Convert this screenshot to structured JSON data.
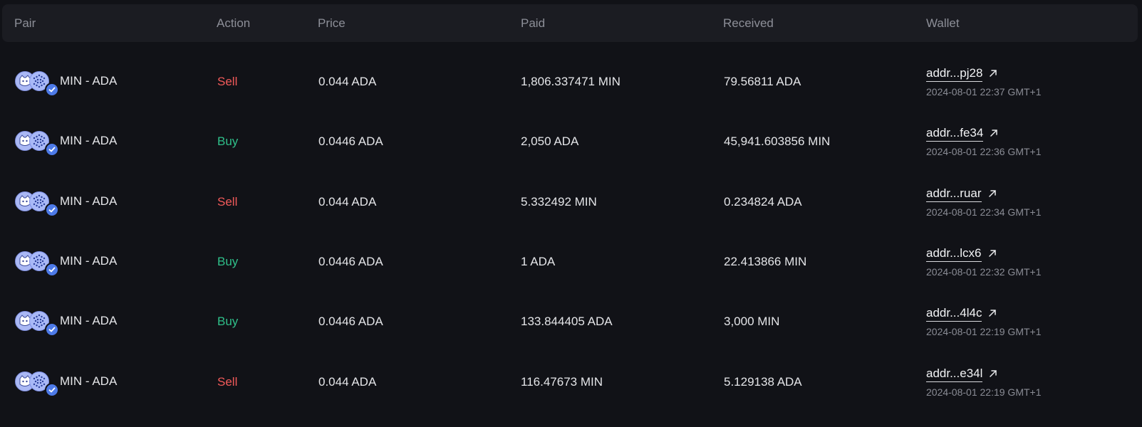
{
  "columns": [
    "Pair",
    "Action",
    "Price",
    "Paid",
    "Received",
    "Wallet"
  ],
  "colors": {
    "sell": "#f25a5a",
    "buy": "#2fbf8a",
    "background": "#111217",
    "header": "#1b1c22"
  },
  "rows": [
    {
      "pair": "MIN - ADA",
      "action": "Sell",
      "price": "0.044 ADA",
      "paid": "1,806.337471 MIN",
      "received": "79.56811 ADA",
      "wallet": "addr...pj28",
      "time": "2024-08-01 22:37 GMT+1"
    },
    {
      "pair": "MIN - ADA",
      "action": "Buy",
      "price": "0.0446 ADA",
      "paid": "2,050 ADA",
      "received": "45,941.603856 MIN",
      "wallet": "addr...fe34",
      "time": "2024-08-01 22:36 GMT+1"
    },
    {
      "pair": "MIN - ADA",
      "action": "Sell",
      "price": "0.044 ADA",
      "paid": "5.332492 MIN",
      "received": "0.234824 ADA",
      "wallet": "addr...ruar",
      "time": "2024-08-01 22:34 GMT+1"
    },
    {
      "pair": "MIN - ADA",
      "action": "Buy",
      "price": "0.0446 ADA",
      "paid": "1 ADA",
      "received": "22.413866 MIN",
      "wallet": "addr...lcx6",
      "time": "2024-08-01 22:32 GMT+1"
    },
    {
      "pair": "MIN - ADA",
      "action": "Buy",
      "price": "0.0446 ADA",
      "paid": "133.844405 ADA",
      "received": "3,000 MIN",
      "wallet": "addr...4l4c",
      "time": "2024-08-01 22:19 GMT+1"
    },
    {
      "pair": "MIN - ADA",
      "action": "Sell",
      "price": "0.044 ADA",
      "paid": "116.47673 MIN",
      "received": "5.129138 ADA",
      "wallet": "addr...e34l",
      "time": "2024-08-01 22:19 GMT+1"
    }
  ],
  "icons": {
    "pair_base": "min-token-icon",
    "pair_quote": "ada-token-icon",
    "verified": "verified-badge-icon",
    "wallet_link": "external-link-icon"
  }
}
